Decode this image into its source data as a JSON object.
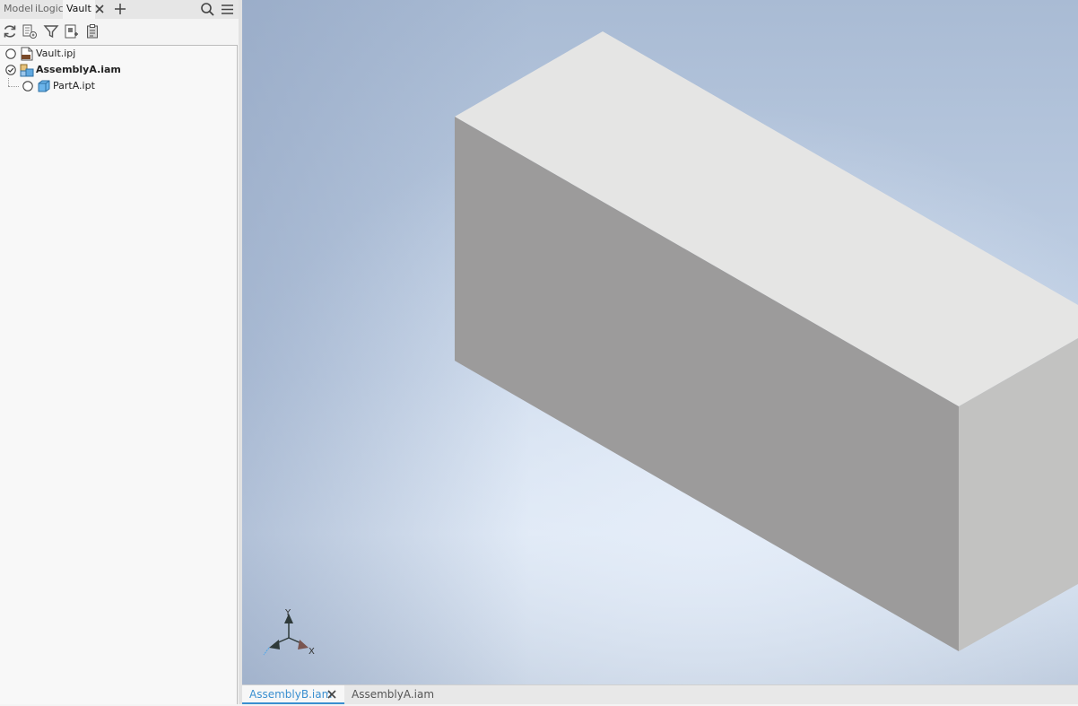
{
  "browser": {
    "tabs": [
      {
        "label": "Model"
      },
      {
        "label": "iLogic"
      },
      {
        "label": "Vault"
      }
    ],
    "toolbar_icons": [
      "refresh-icon",
      "checkin-icon",
      "filter-icon",
      "get-revision-icon",
      "clipboard-icon"
    ],
    "tree": [
      {
        "label": "Vault.ipj",
        "status": "not-in-vault",
        "icon": "project-file-icon"
      },
      {
        "label": "AssemblyA.iam",
        "status": "checked-in",
        "icon": "assembly-file-icon",
        "bold": true
      },
      {
        "label": "PartA.ipt",
        "status": "not-in-vault",
        "icon": "part-file-icon"
      }
    ]
  },
  "viewport": {
    "background_top": "#9fb2cd",
    "background_bottom": "#dfe9f6",
    "box_colors": {
      "top": "#e5e5e4",
      "front": "#9c9b9b",
      "side": "#c2c2c1"
    },
    "triad": {
      "y_label": "Y",
      "x_label": "X"
    }
  },
  "document_tabs": [
    {
      "label": "AssemblyB.iam",
      "active": true
    },
    {
      "label": "AssemblyA.iam",
      "active": false
    }
  ],
  "colors": {
    "accent": "#3a8fd0"
  }
}
